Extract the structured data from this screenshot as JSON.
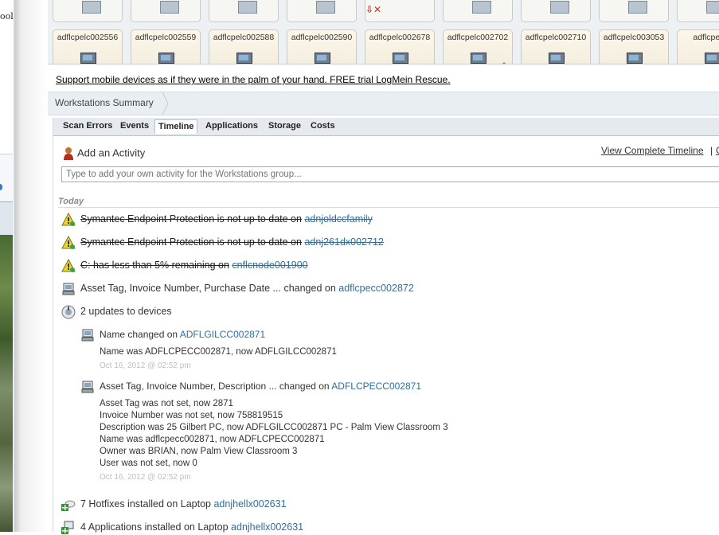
{
  "background_window": {
    "partial_text": "ool"
  },
  "device_tiles": [
    {
      "name": "adflcpelc002556"
    },
    {
      "name": "adflcpelc002559"
    },
    {
      "name": "adflcpelc002588"
    },
    {
      "name": "adflcpelc002590"
    },
    {
      "name": "adflcpelc002678"
    },
    {
      "name": "adflcpelc002702"
    },
    {
      "name": "adflcpelc002710"
    },
    {
      "name": "adflcpelc003053"
    },
    {
      "name": "adflcpelc0"
    }
  ],
  "ad": {
    "text": "Support mobile devices as if they were in the palm of your hand. FREE trial LogMein Rescue."
  },
  "summary": {
    "title": "Workstations Summary"
  },
  "tabs": [
    {
      "label": "Scan Errors",
      "active": false
    },
    {
      "label": "Events",
      "active": false
    },
    {
      "label": "Timeline",
      "active": true
    },
    {
      "label": "Applications",
      "active": false
    },
    {
      "label": "Storage",
      "active": false
    },
    {
      "label": "Costs",
      "active": false
    }
  ],
  "activity": {
    "add_label": "Add an Activity",
    "view_complete": "View Complete Timeline",
    "separator": "|",
    "next_link_partial": "C",
    "input_placeholder": "Type to add your own activity for the Workstations group..."
  },
  "timeline": {
    "section": "Today",
    "items": [
      {
        "icon": "warning-icon",
        "text": "Symantec Endpoint Protection is not up to date on",
        "link": "adnjoldccfamily"
      },
      {
        "icon": "warning-icon",
        "text": "Symantec Endpoint Protection is not up to date on",
        "link": "adnj261dx002712"
      },
      {
        "icon": "warning-icon",
        "text": "C: has less than 5% remaining on",
        "link": "cnflcnode001900"
      },
      {
        "icon": "computer-icon",
        "text": "Asset Tag, Invoice Number, Purchase Date ... changed on",
        "link": "adflcpecc002872"
      },
      {
        "icon": "update-icon",
        "text": "2 updates to devices",
        "link": ""
      }
    ],
    "sub_items": [
      {
        "text": "Name changed on",
        "link": "ADFLGILCC002871",
        "details": [
          "Name was ADFLCPECC002871, now ADFLGILCC002871"
        ],
        "timestamp": "Oct 16, 2012 @ 02:52 pm"
      },
      {
        "text": "Asset Tag, Invoice Number, Description ... changed on",
        "link": "ADFLCPECC002871",
        "details": [
          "Asset Tag was not set, now 2871",
          "Invoice Number was not set, now 758819515",
          "Description was 25 Gilbert PC, now ADFLGILCC002871 PC - Palm View Classroom 3",
          "Name was adflcpecc002871, now ADFLCPECC002871",
          "Owner was BRIAN, now Palm View Classroom 3",
          "User was not set, now 0"
        ],
        "timestamp": "Oct 16, 2012 @ 02:52 pm"
      }
    ],
    "bottom_items": [
      {
        "icon": "hotfix-icon",
        "text": "7 Hotfixes installed on Laptop",
        "link": "adnjhellx002631"
      },
      {
        "icon": "applications-icon",
        "text": "4 Applications installed on Laptop",
        "link": "adnjhellx002631"
      }
    ]
  },
  "colors": {
    "link": "#2f6f9a",
    "tab_bar": "#e6e9ed",
    "summary_bar": "#e9eef3"
  }
}
